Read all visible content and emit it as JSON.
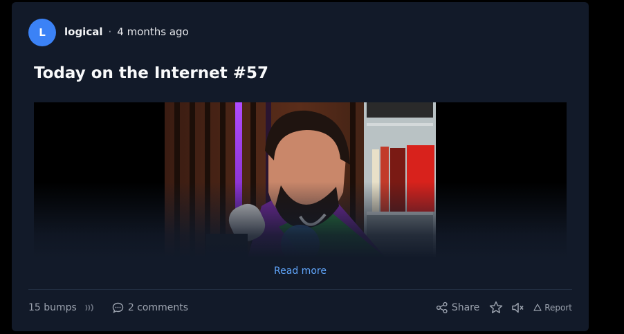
{
  "post": {
    "author_initial": "L",
    "author": "logical",
    "separator": "·",
    "time": "4 months ago",
    "title": "Today on the Internet #57",
    "read_more": "Read more"
  },
  "footer": {
    "bumps": "15 bumps",
    "comments": "2 comments",
    "share": "Share",
    "report": "Report"
  },
  "colors": {
    "accent": "#3b82f6",
    "link": "#60a5fa",
    "card_bg": "#121a29"
  },
  "icons": [
    "bump-icon",
    "comment-icon",
    "share-icon",
    "star-icon",
    "mute-icon",
    "report-icon"
  ]
}
